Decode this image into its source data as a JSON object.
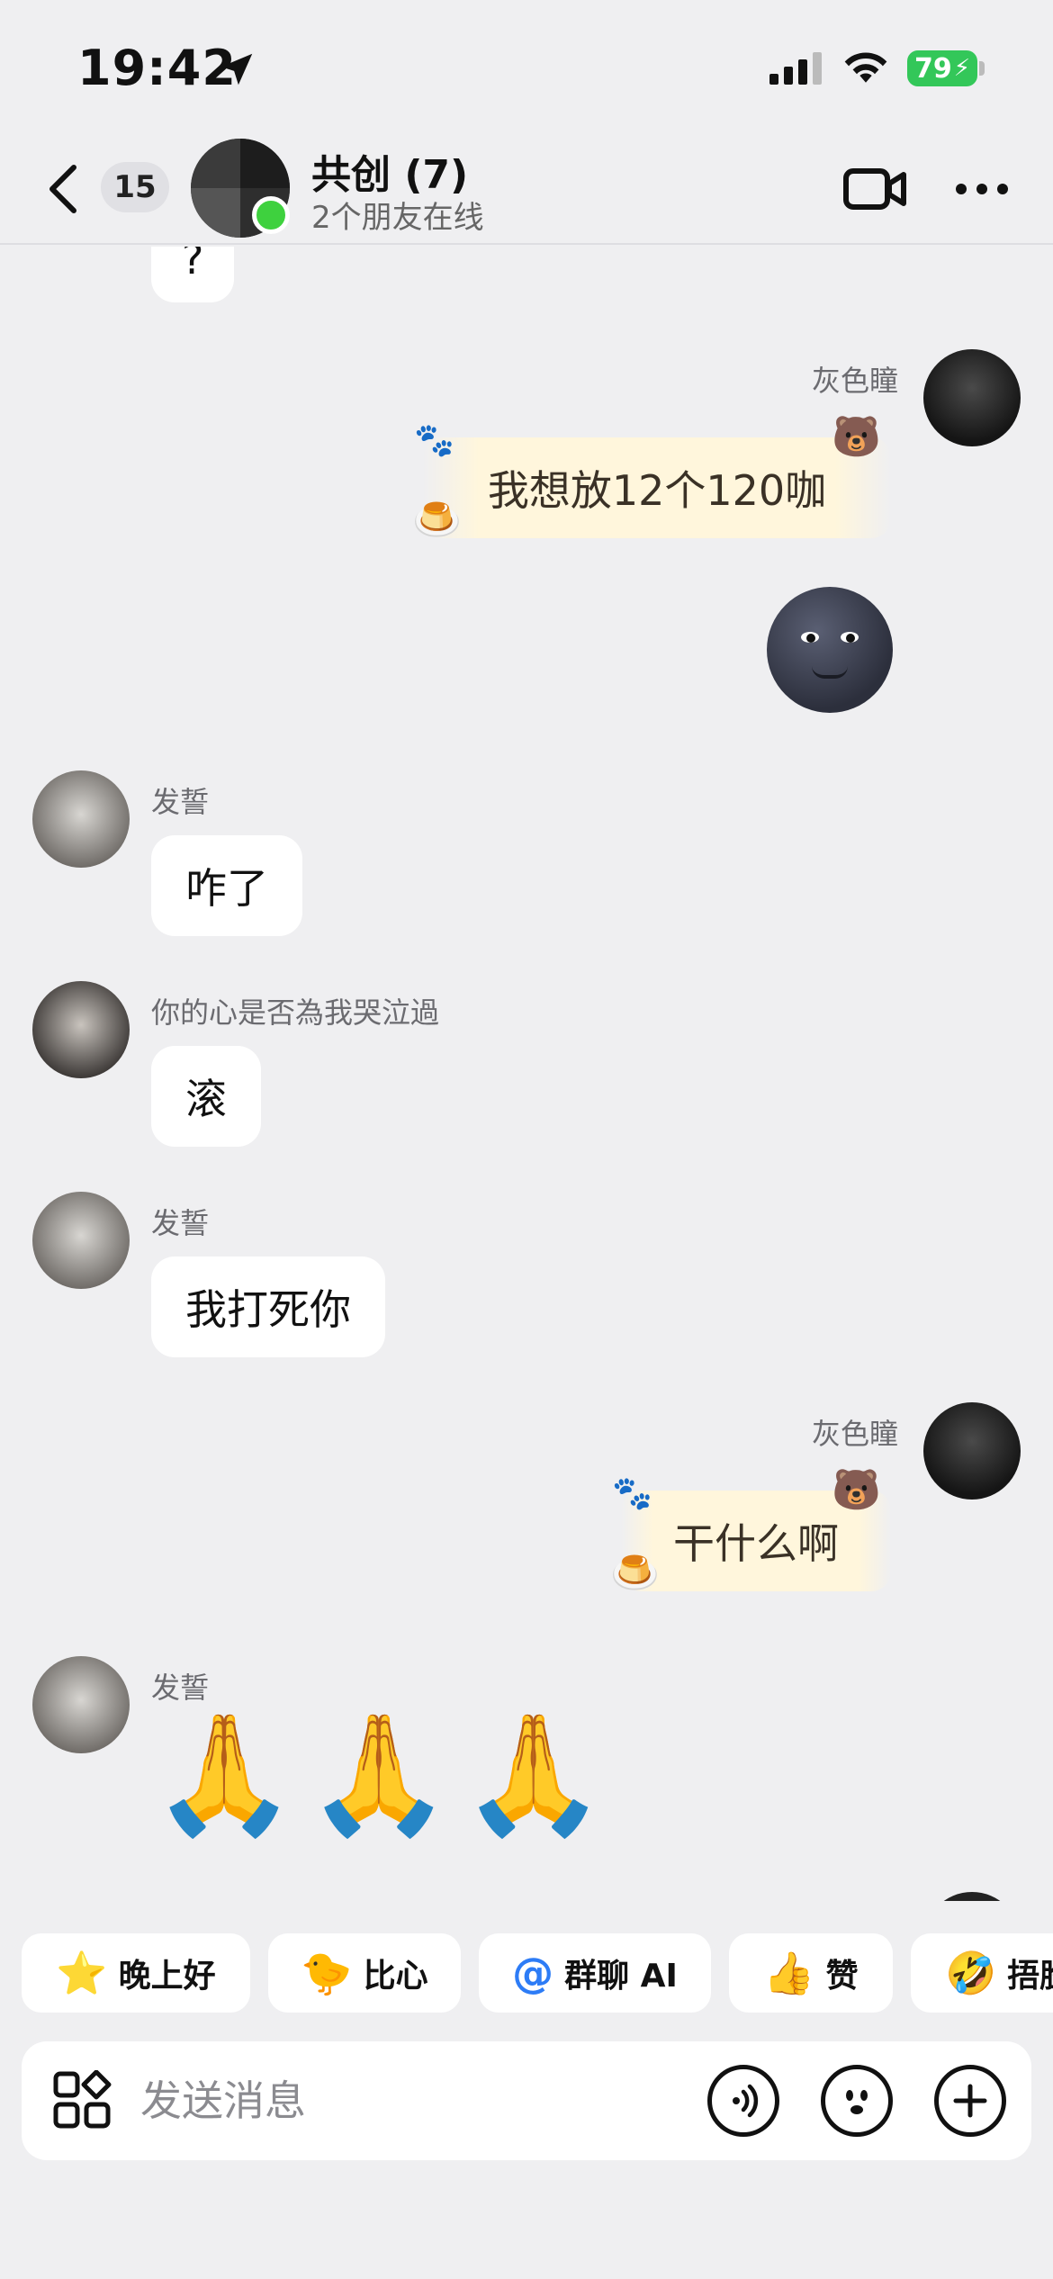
{
  "status_bar": {
    "time": "19:42",
    "battery": "79"
  },
  "header": {
    "unread_count": "15",
    "title": "共创 (7)",
    "subtitle": "2个朋友在线"
  },
  "messages": {
    "m0_text": "?",
    "m1_sender": "灰色瞳",
    "m1_text": "我想放12个120咖",
    "m3_sender": "发誓",
    "m3_text": "咋了",
    "m4_sender": "你的心是否為我哭泣過",
    "m4_text": "滚",
    "m5_sender": "发誓",
    "m5_text": "我打死你",
    "m6_sender": "灰色瞳",
    "m6_text": "干什么啊",
    "m7_sender": "发誓",
    "m7_emojis": "🙏🙏🙏"
  },
  "quick_replies": [
    {
      "icon": "⭐",
      "label": "晚上好"
    },
    {
      "icon": "🐤",
      "label": "比心"
    },
    {
      "icon": "@",
      "label": "群聊 AI"
    },
    {
      "icon": "👍",
      "label": "赞"
    },
    {
      "icon": "🤣",
      "label": "捂脸"
    }
  ],
  "input": {
    "placeholder": "发送消息"
  }
}
